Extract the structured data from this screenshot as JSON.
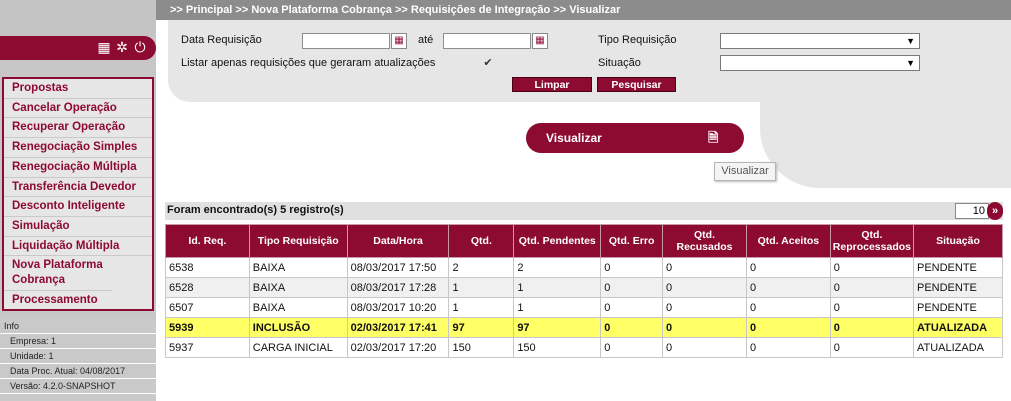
{
  "breadcrumb": ">> Principal >> Nova Plataforma Cobrança >> Requisições de Integração >> Visualizar",
  "sidebar": {
    "menu": [
      "Propostas",
      "Cancelar Operação",
      "Recuperar Operação",
      "Renegociação Simples",
      "Renegociação Múltipla",
      "Transferência Devedor",
      "Desconto Inteligente",
      "Simulação",
      "Liquidação Múltipla",
      "Nova Plataforma Cobrança",
      "Processamento"
    ],
    "info_title": "Info",
    "info": [
      "Empresa: 1",
      "Unidade: 1",
      "Data Proc. Atual: 04/08/2017",
      "Versão: 4.2.0-SNAPSHOT"
    ]
  },
  "filter": {
    "data_label": "Data Requisição",
    "ate_label": "até",
    "listar_label": "Listar apenas requisições que geraram atualizações",
    "tipo_label": "Tipo Requisição",
    "situacao_label": "Situação",
    "limpar": "Limpar",
    "pesquisar": "Pesquisar"
  },
  "visualizar": {
    "button": "Visualizar",
    "tooltip": "Visualizar"
  },
  "results": {
    "summary": "Foram encontrado(s) 5 registro(s)",
    "page_size": "10",
    "columns": [
      "Id. Req.",
      "Tipo Requisição",
      "Data/Hora",
      "Qtd.",
      "Qtd. Pendentes",
      "Qtd. Erro",
      "Qtd. Recusados",
      "Qtd. Aceitos",
      "Qtd. Reprocessados",
      "Situação"
    ],
    "rows": [
      [
        "6538",
        "BAIXA",
        "08/03/2017 17:50",
        "2",
        "2",
        "0",
        "0",
        "0",
        "0",
        "PENDENTE"
      ],
      [
        "6528",
        "BAIXA",
        "08/03/2017 17:28",
        "1",
        "1",
        "0",
        "0",
        "0",
        "0",
        "PENDENTE"
      ],
      [
        "6507",
        "BAIXA",
        "08/03/2017 10:20",
        "1",
        "1",
        "0",
        "0",
        "0",
        "0",
        "PENDENTE"
      ],
      [
        "5939",
        "INCLUSÃO",
        "02/03/2017 17:41",
        "97",
        "97",
        "0",
        "0",
        "0",
        "0",
        "ATUALIZADA"
      ],
      [
        "5937",
        "CARGA INICIAL",
        "02/03/2017 17:20",
        "150",
        "150",
        "0",
        "0",
        "0",
        "0",
        "ATUALIZADA"
      ]
    ]
  },
  "colors": {
    "brand": "#8d0a31",
    "highlight": "#ffff66"
  }
}
